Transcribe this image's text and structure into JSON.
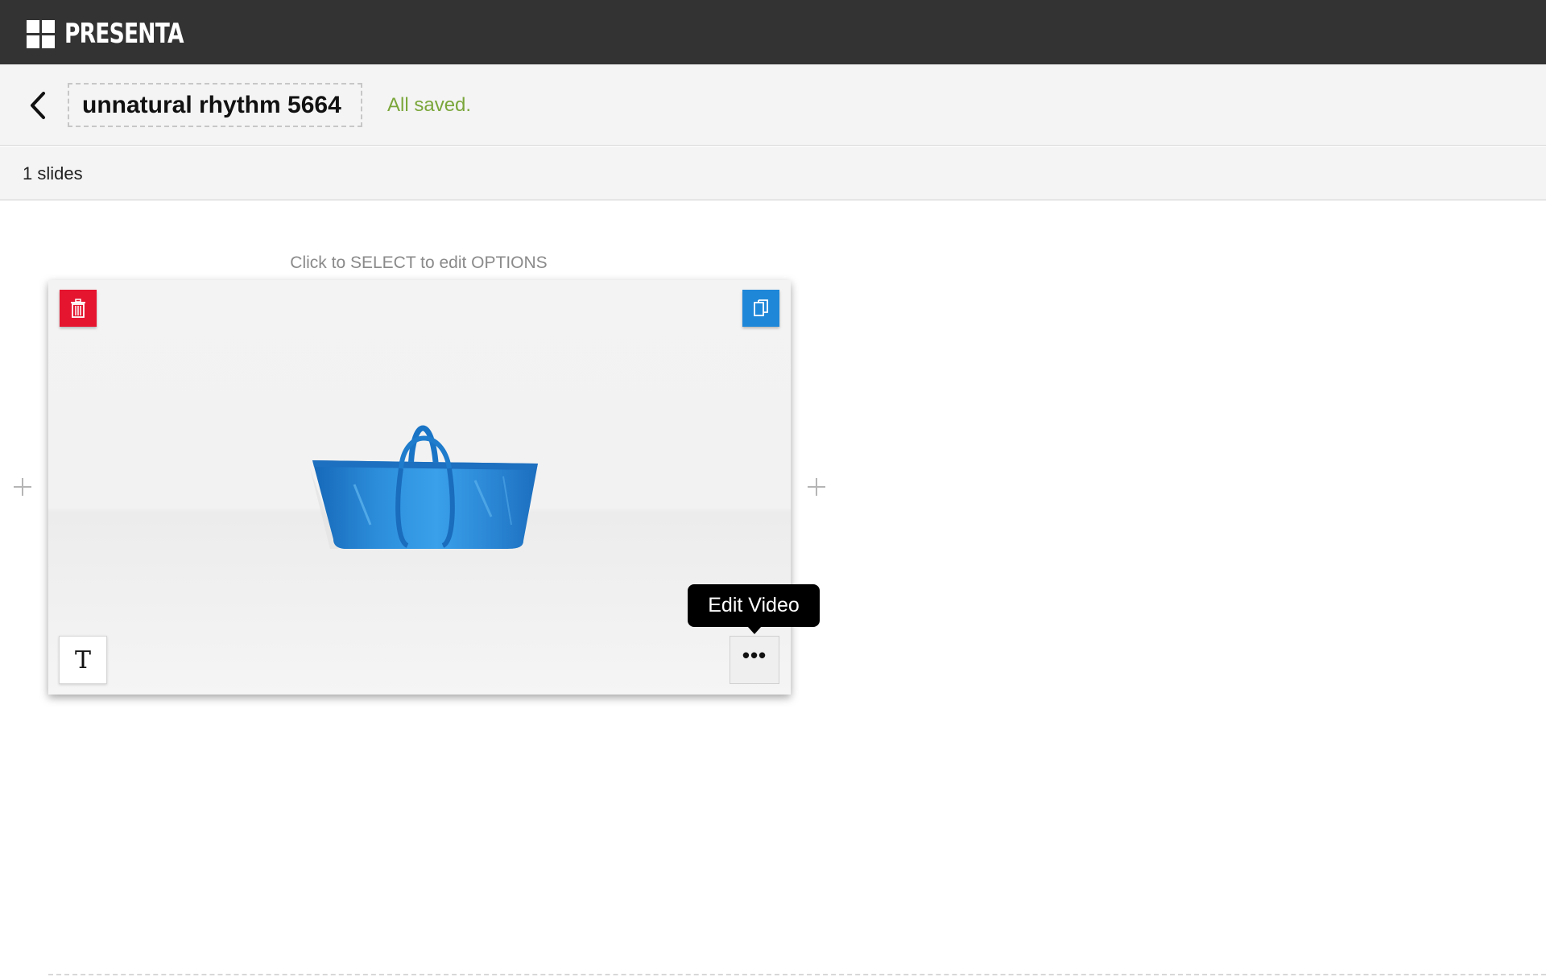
{
  "app": {
    "brand": "PRESENTA",
    "colors": {
      "topbar": "#333333",
      "saved_status": "#7aa63a",
      "delete": "#e5142f",
      "copy": "#1f87d8"
    }
  },
  "header": {
    "back_icon": "chevron-left-icon",
    "presentation_title": "unnatural rhythm 5664",
    "save_status": "All saved."
  },
  "toolbar": {
    "slide_count": "1 slides"
  },
  "workspace": {
    "hint": "Click to SELECT to edit OPTIONS",
    "add_slide_icon": "plus-icon",
    "slide": {
      "delete_icon": "trash-icon",
      "copy_icon": "duplicate-icon",
      "text_button_label": "T",
      "more_button_label": "•••",
      "tooltip": "Edit Video",
      "media": "blue-tote-bag-image"
    }
  }
}
